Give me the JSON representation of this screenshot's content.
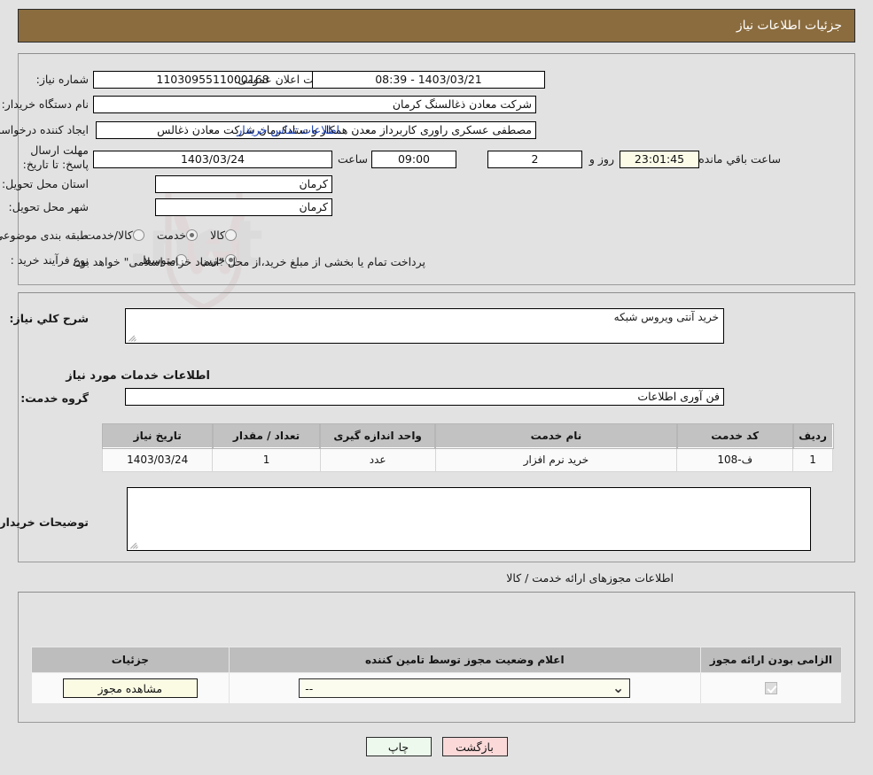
{
  "header": {
    "title": "جزئیات اطلاعات نیاز"
  },
  "need_info": {
    "need_number_label": "شماره نیاز:",
    "need_number_value": "1103095511000168",
    "announce_datetime_label": "تاریخ و ساعت اعلان عمومی:",
    "announce_datetime_value": "1403/03/21 - 08:39",
    "buyer_org_label": "نام دستگاه خریدار:",
    "buyer_org_value": "شرکت معادن ذغالسنگ کرمان",
    "creator_label": "ایجاد کننده درخواست:",
    "creator_value": "مصطفی عسکری راوری کاربرداز معدن همکار و ستادکرمان شرکت معادن ذغالس",
    "buyer_contact_link": "اطلاعات تماس خریدار",
    "deadline_label": "مهلت ارسال پاسخ: تا تاریخ:",
    "deadline_date": "1403/03/24",
    "deadline_time_label": "ساعت",
    "deadline_time": "09:00",
    "remaining_days": "2",
    "remaining_days_label": "روز و",
    "remaining_time": "23:01:45",
    "remaining_time_label": "ساعت باقي مانده",
    "province_label": "استان محل تحویل:",
    "province_value": "کرمان",
    "city_label": "شهر محل تحویل:",
    "city_value": "کرمان",
    "category_label": "طبقه بندی موضوعی:",
    "category_options": [
      {
        "label": "کالا",
        "selected": false
      },
      {
        "label": "خدمت",
        "selected": true
      },
      {
        "label": "کالا/خدمت",
        "selected": false
      }
    ],
    "process_label": "نوع فرآیند خرید :",
    "process_options": [
      {
        "label": "جزیي",
        "selected": true
      },
      {
        "label": "متوسط",
        "selected": false
      }
    ],
    "payment_note": "پرداخت تمام یا بخشی از مبلغ خرید،از محل \"اسناد خزانه اسلامی\" خواهد بود."
  },
  "need_detail": {
    "summary_label": "شرح کلي نیاز:",
    "summary_value": "خرید آنتی ویروس شبکه",
    "services_heading": "اطلاعات خدمات مورد نیاز",
    "service_group_label": "گروه خدمت:",
    "service_group_value": "فن آوری اطلاعات",
    "buyer_notes_label": "توضیحات خریدار:",
    "buyer_notes_value": ""
  },
  "service_table": {
    "columns": [
      "ردیف",
      "کد خدمت",
      "نام خدمت",
      "واحد اندازه گیری",
      "تعداد / مقدار",
      "تاریخ نیاز"
    ],
    "rows": [
      {
        "row_no": "1",
        "service_code": "ف-108",
        "service_name": "خرید نرم افزار",
        "unit": "عدد",
        "quantity": "1",
        "need_date": "1403/03/24"
      }
    ]
  },
  "permits": {
    "section_label": "اطلاعات مجوزهای ارائه خدمت / کالا",
    "columns": [
      "الزامی بودن ارائه مجوز",
      "اعلام وضعیت مجوز توسط تامین کننده",
      "جزئیات"
    ],
    "rows": [
      {
        "required_checked": true,
        "status_value": "--",
        "details_button": "مشاهده مجوز"
      }
    ]
  },
  "footer": {
    "print_label": "چاپ",
    "back_label": "بازگشت"
  },
  "colors": {
    "header_bar": "#8b6c3e",
    "page_bg": "#e2e2e2",
    "link": "#1b3fb0",
    "table_header": "#c2c2c2",
    "print_button": "#ecf9ec",
    "back_button": "#fbd9d9",
    "highlight_field": "#fbfbe8"
  }
}
